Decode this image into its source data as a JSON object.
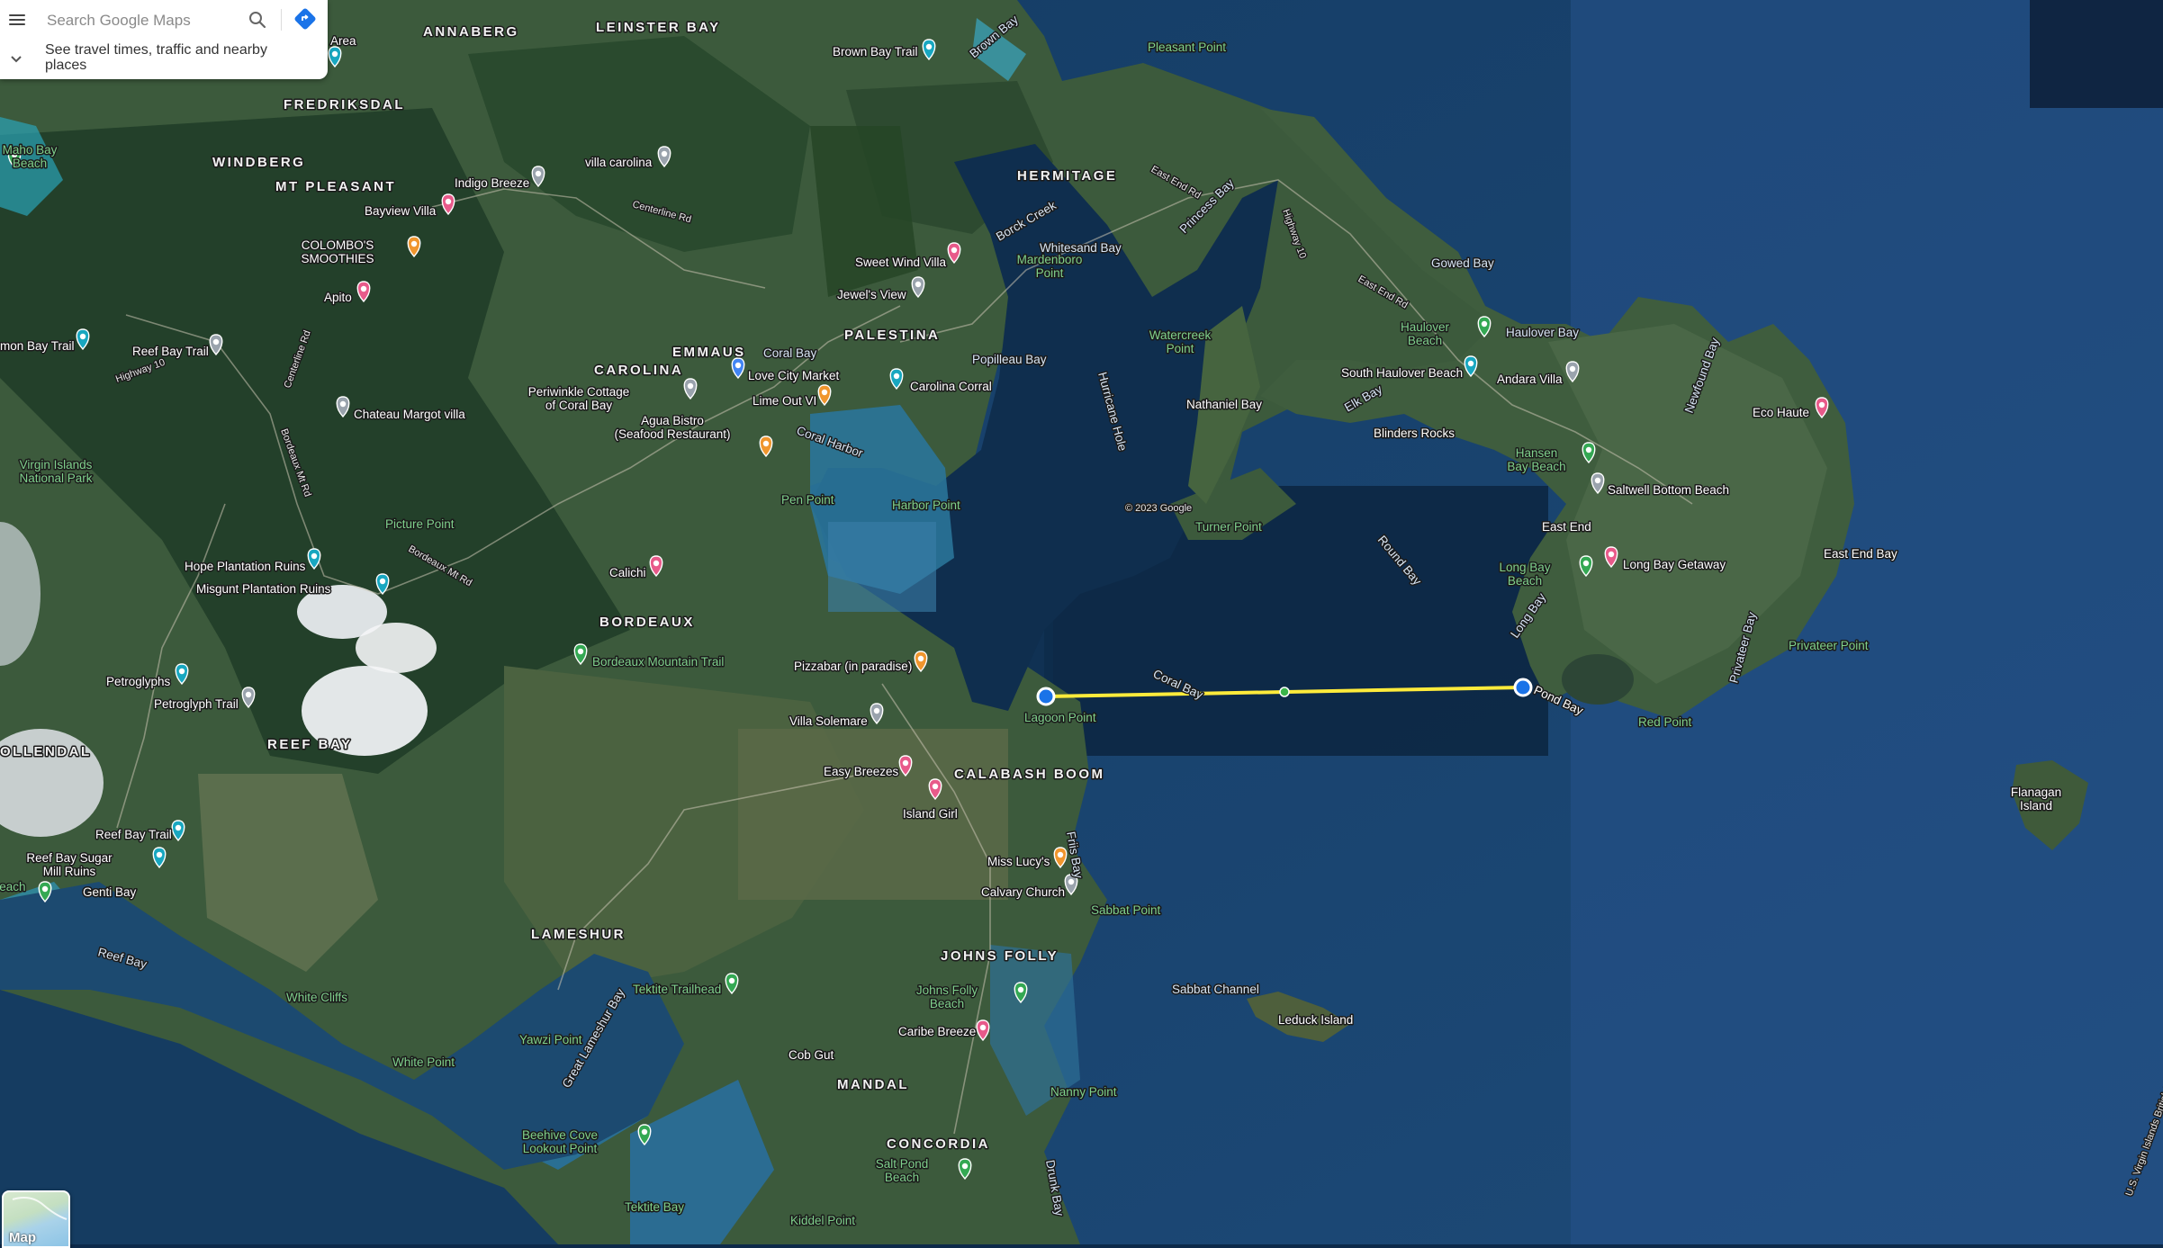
{
  "search": {
    "placeholder": "Search Google Maps",
    "hint": "See travel times, traffic and nearby places"
  },
  "icons": {
    "menu": "menu-icon",
    "search": "search-icon",
    "directions": "directions-icon",
    "expand": "chevron-down-icon",
    "layers": "layers-icon"
  },
  "layer_switch": {
    "label": "Map"
  },
  "colors": {
    "measure_line": "#ffeb3b",
    "measure_point": "#1a73e8",
    "pin_pink": "#e85a8a",
    "pin_orange": "#f0962e",
    "pin_gray": "#9aa3ad",
    "pin_teal": "#18a7c0",
    "pin_green": "#34a853",
    "pin_blue": "#4285f4"
  },
  "areas": [
    "ANNABERG",
    "LEINSTER BAY",
    "FREDRIKSDAL",
    "WINDBERG",
    "MT PLEASANT",
    "HERMITAGE",
    "EMMAUS",
    "PALESTINA",
    "CAROLINA",
    "BORDEAUX",
    "REEF BAY",
    "CALABASH BOOM",
    "LAMESHUR",
    "JOHNS FOLLY",
    "MANDAL",
    "CONCORDIA",
    "OLLENDAL"
  ],
  "water": [
    "Coral Bay",
    "Coral Harbor",
    "Hurricane Hole",
    "Round Bay",
    "Coral Bay",
    "Princess Bay",
    "Borck Creek",
    "Whitesand Bay",
    "Popilleau Bay",
    "Elk Bay",
    "Gowed Bay",
    "Haulover Bay",
    "Newfound Bay",
    "Long Bay",
    "Privateer Bay",
    "Sabbat Channel",
    "Friis Bay",
    "Great Lameshur Bay",
    "Drunk Bay",
    "Genti Bay",
    "Reef Bay",
    "Brown Bay"
  ],
  "places": [
    "Brown Bay Trail",
    "Pleasant Point",
    "Area",
    "Maho Bay Beach",
    "Indigo Breeze",
    "villa carolina",
    "Bayview Villa",
    "COLOMBO'S SMOOTHIES",
    "Apito",
    "Reef Bay Trail",
    "mon Bay Trail",
    "Chateau Margot villa",
    "Virgin Islands National Park",
    "Sweet Wind Villa",
    "Jewel's View",
    "Love City Market",
    "Periwinkle Cottage of Coral Bay",
    "Lime Out VI",
    "Carolina Corral",
    "Agua Bistro (Seafood Restaurant)",
    "Pen Point",
    "Harbor Point",
    "Mardenboro Point",
    "Watercreek Point",
    "Nathaniel Bay",
    "Turner Point",
    "South Haulover Beach",
    "Haulover Beach",
    "Blinders Rocks",
    "Andara Villa",
    "Eco Haute",
    "Hansen Bay Beach",
    "Saltwell Bottom Beach",
    "East End",
    "Long Bay Beach",
    "Long Bay Getaway",
    "East End Bay",
    "Privateer Point",
    "Pond Bay",
    "Red Point",
    "Lagoon Point",
    "Picture Point",
    "Hope Plantation Ruins",
    "Misgunt Plantation Ruins",
    "Calichi",
    "Bordeaux Mountain Trail",
    "Pizzabar (in paradise)",
    "Villa Solemare",
    "Petroglyphs",
    "Petroglyph Trail",
    "Easy Breezes",
    "Island Girl",
    "Miss Lucy's",
    "Calvary Church",
    "Sabbat Point",
    "Reef Bay Trail",
    "Reef Bay Sugar Mill Ruins",
    "ee Beach",
    "Genti Bay",
    "Tektite Trailhead",
    "White Cliffs",
    "Yawzi Point",
    "White Point",
    "Johns Folly Beach",
    "Caribe Breeze",
    "Cob Gut",
    "Leduck Island",
    "Flanagan Island",
    "Nanny Point",
    "Beehive Cove Lookout Point",
    "Tektite Bay",
    "Salt Pond Beach",
    "Kiddel Point",
    "© 2023 Google"
  ],
  "roads": [
    "East End Rd",
    "Centerline Rd",
    "Highway 10",
    "Centerline Rd",
    "Bordeaux Mt Rd",
    "Bordeaux Mt Rd",
    "Highway 10",
    "East End Rd",
    "U.S. Virgin Islands British Virgin Is."
  ]
}
